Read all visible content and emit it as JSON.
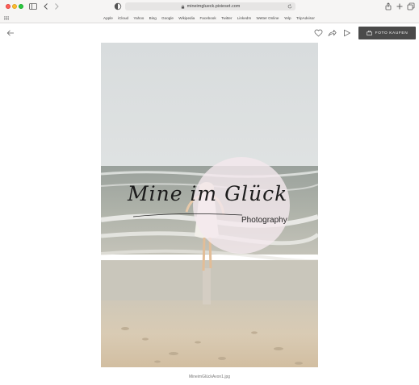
{
  "browser": {
    "url": "mineimglueck.pixieset.com",
    "favorites": [
      "Apple",
      "iCloud",
      "Yahoo",
      "Bing",
      "Google",
      "Wikipedia",
      "Facebook",
      "Twitter",
      "LinkedIn",
      "Wetter Online",
      "Yelp",
      "TripAdvisor"
    ]
  },
  "toolbar": {
    "buy_label": "FOTO KAUFEN"
  },
  "photo": {
    "watermark_script": "Mine im Glück",
    "watermark_sub": "Photography",
    "filename": "MineimGlückAvon1.jpg"
  },
  "icons": {
    "back": "arrow-left-icon",
    "favorite": "heart-icon",
    "share": "share-icon",
    "slideshow": "play-icon",
    "cart": "shopping-bag-icon"
  },
  "colors": {
    "buy_button": "#4a4a4a",
    "page_background": "#ffffff"
  }
}
